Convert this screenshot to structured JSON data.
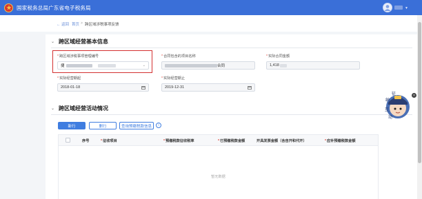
{
  "header": {
    "site_title": "国家税务总局广东省电子税务局"
  },
  "breadcrumb": {
    "back": "← 返回",
    "home": "首页",
    "separator": ">",
    "current": "跨区域涉税事项反馈"
  },
  "section1": {
    "title": "跨区域经营基本信息",
    "fields": {
      "mgmt_no_label": "跨区域涉税事项管理编号",
      "mgmt_no_value_prefix": "捷",
      "contract_name_label": "合同包含的项目名称",
      "contract_name_value_suffix": "合同",
      "contract_amount_label": "实际合同金额",
      "contract_amount_value": "1,418",
      "start_date_label": "实际经营期起",
      "start_date_value": "2018-01-18",
      "end_date_label": "实际经营期止",
      "end_date_value": "2019-12-31"
    }
  },
  "section2": {
    "title": "跨区域经营活动情况",
    "buttons": {
      "add": "新行",
      "delete": "删行",
      "query": "查询预缴税款信息"
    },
    "info_icon": "i",
    "columns": [
      "序号",
      "征收项目",
      "预缴税款征收税率",
      "已预缴税款金额",
      "开具发票金额（含自开和代开）",
      "应补预缴税款金额"
    ],
    "empty_text": "暂无数据"
  },
  "mascot": {
    "text": [
      "纳",
      "互",
      "动",
      "征"
    ]
  },
  "close_icon": "×",
  "colors": {
    "header_blue": "#3a6fd8",
    "primary": "#3f7de0",
    "required": "#e0463a",
    "highlight": "#d32f2f"
  }
}
